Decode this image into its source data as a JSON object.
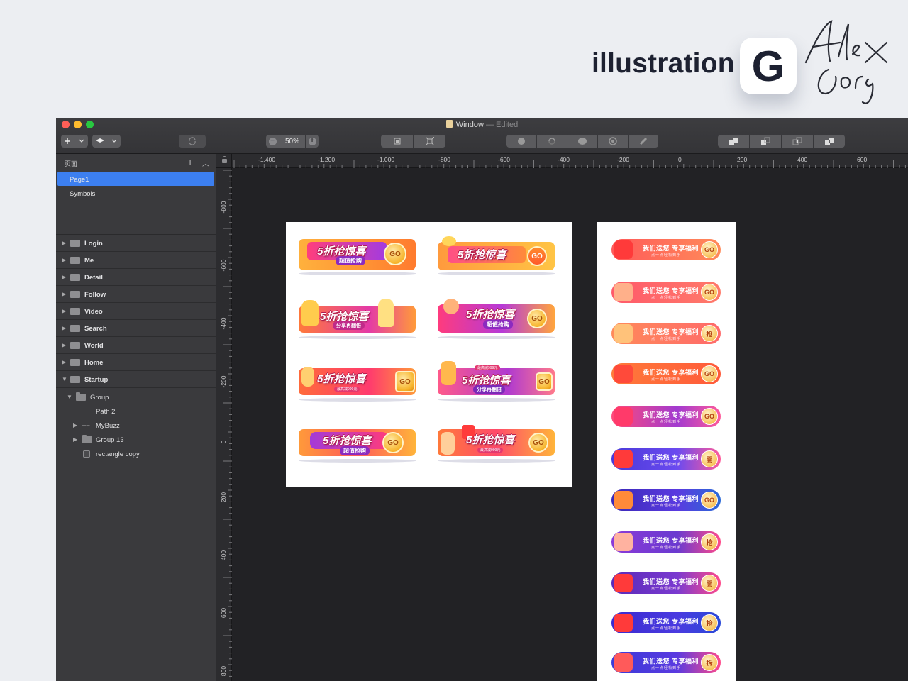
{
  "brand": {
    "text": "illustration",
    "logo_letter": "G",
    "signature": "Alex Gorg"
  },
  "window": {
    "title": "Window",
    "title_suffix": "— Edited",
    "toolbar": {
      "insert_icon": "plus-icon",
      "zoom_value": "50%",
      "zoom_out": "−",
      "zoom_in": "+"
    }
  },
  "sidebar": {
    "pages_header": "页面",
    "add_label": "+",
    "pages": [
      {
        "label": "Page1",
        "selected": true
      },
      {
        "label": "Symbols",
        "selected": false
      }
    ],
    "artboards": [
      {
        "label": "Login"
      },
      {
        "label": "Me"
      },
      {
        "label": "Detail"
      },
      {
        "label": "Follow"
      },
      {
        "label": "Video"
      },
      {
        "label": "Search"
      },
      {
        "label": "World"
      },
      {
        "label": "Home"
      },
      {
        "label": "Startup"
      }
    ],
    "startup_children": [
      {
        "label": "Group"
      },
      {
        "label": "Path 2"
      },
      {
        "label": "MyBuzz"
      },
      {
        "label": "Group 13"
      },
      {
        "label": "rectangle copy"
      }
    ]
  },
  "rulers": {
    "horizontal": [
      "-1,400",
      "-1,200",
      "-1,000",
      "-800",
      "-600",
      "-400",
      "-200",
      "0",
      "200",
      "400",
      "600"
    ],
    "vertical": [
      "-800",
      "-600",
      "-400",
      "-200",
      "0",
      "200",
      "400",
      "600",
      "800"
    ]
  },
  "banners_left": {
    "title": "5折抢惊喜",
    "sub1": "超值抢购",
    "sub2": "分享再翻倍",
    "note": "最高减999元",
    "go": "GO"
  },
  "banners_right": {
    "title": "我们送您 专享福利",
    "sub": "点一点轻松到手",
    "buttons": [
      "GO",
      "GO",
      "抢",
      "GO",
      "GO",
      "開",
      "GO",
      "抢",
      "開",
      "抢",
      "拆"
    ]
  },
  "colors": {
    "selection": "#3c7ff0",
    "canvas": "#222225",
    "sidebar": "#3a3a3d"
  }
}
